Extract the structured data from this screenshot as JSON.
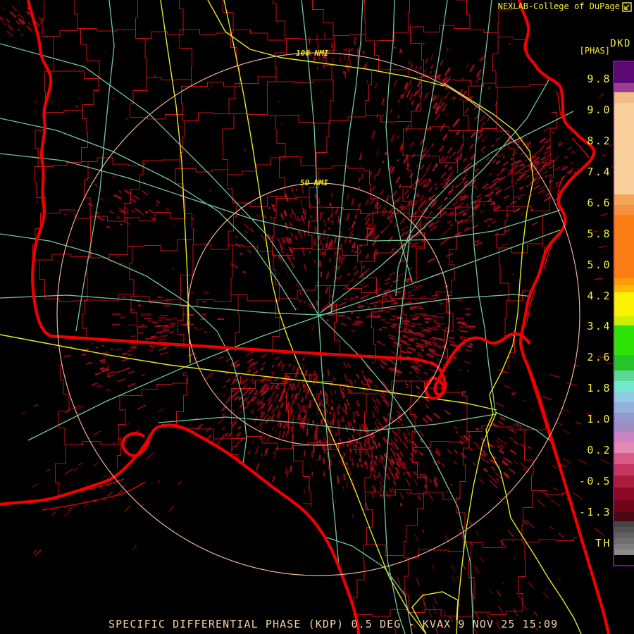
{
  "header": {
    "source": "NEXLAB-College of DuPage",
    "expand_icon": "box-arrow"
  },
  "product": {
    "code": "DKD",
    "phase_label": "[PHAS]"
  },
  "rings": {
    "label_100": "100 NMI",
    "label_50": "50 NMI"
  },
  "status": {
    "text": "SPECIFIC DIFFERENTIAL PHASE (KDP) 0.5 DEG - KVAX 9 NOV 25 15:09"
  },
  "colorbar": {
    "labels": [
      "9.8",
      "9.0",
      "8.2",
      "7.4",
      "6.6",
      "5.8",
      "5.0",
      "4.2",
      "3.4",
      "2.6",
      "1.8",
      "1.0",
      "0.2",
      "-0.5",
      "-1.3",
      "TH"
    ],
    "label_start_y": 112,
    "label_step_y": 43.93,
    "border_color": "#8a00b4",
    "segments": [
      [
        30,
        "#5c0973"
      ],
      [
        13,
        "#9c3f93"
      ],
      [
        15,
        "#f0bd86"
      ],
      [
        130,
        "#f9cf9b"
      ],
      [
        15,
        "#f3a658"
      ],
      [
        14,
        "#f69041"
      ],
      [
        90,
        "#fa7d14"
      ],
      [
        10,
        "#fc9b06"
      ],
      [
        10,
        "#fcba04"
      ],
      [
        34,
        "#fbf303"
      ],
      [
        13,
        "#cfee04"
      ],
      [
        42,
        "#2fe206"
      ],
      [
        22,
        "#26c32a"
      ],
      [
        15,
        "#5dd795"
      ],
      [
        15,
        "#74e8cc"
      ],
      [
        15,
        "#8fcbe3"
      ],
      [
        15,
        "#93b1da"
      ],
      [
        14,
        "#939aca"
      ],
      [
        13,
        "#a28bc0"
      ],
      [
        14,
        "#ca84c4"
      ],
      [
        16,
        "#e289b5"
      ],
      [
        16,
        "#da5b86"
      ],
      [
        16,
        "#c43560"
      ],
      [
        17,
        "#a91c3c"
      ],
      [
        18,
        "#8d0927"
      ],
      [
        17,
        "#6f0317"
      ],
      [
        13,
        "#49070f"
      ],
      [
        8,
        "#454545"
      ],
      [
        8,
        "#535353"
      ],
      [
        8,
        "#616161"
      ],
      [
        8,
        "#6f6f6f"
      ],
      [
        8,
        "#7d7d7d"
      ],
      [
        8,
        "#8b8b8b"
      ],
      [
        14,
        "#000000"
      ]
    ]
  },
  "colors": {
    "background": "#000000",
    "county_line": "#c41111",
    "state_line": "#f20000",
    "road_green": "#72c79b",
    "road_yellow": "#e9e823",
    "range_ring": "#f2b392",
    "ring_label_text": "#efe42a",
    "scale_label_text": "#f8ef3f",
    "header_text": "#f3ed3a",
    "status_text": "#f3cfa2",
    "echo_palette": [
      "#5e0309",
      "#70050e",
      "#7e0812",
      "#8c0c16",
      "#9a101c"
    ]
  },
  "radar": {
    "site": "KVAX",
    "elevation": "0.5 DEG",
    "ring_50_nmi": 50,
    "ring_100_nmi": 100
  }
}
